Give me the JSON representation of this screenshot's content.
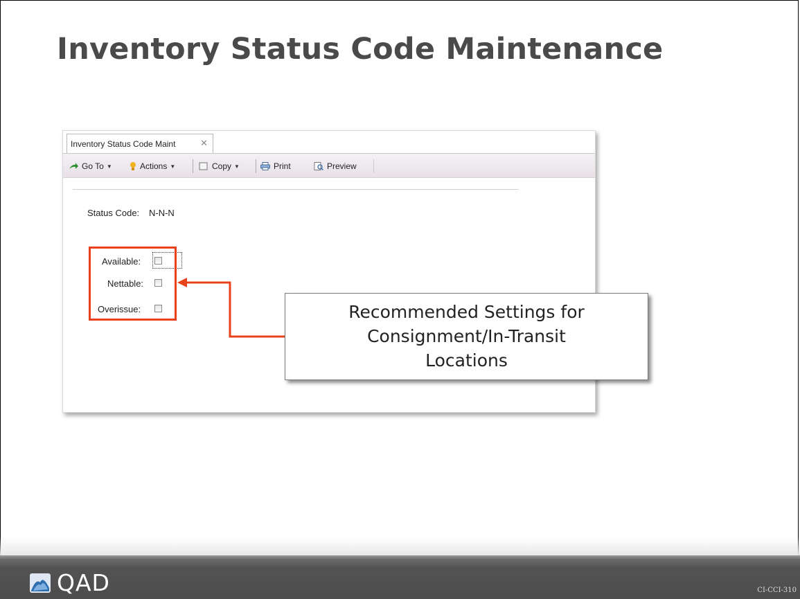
{
  "slide": {
    "title": "Inventory Status Code Maintenance",
    "code": "CI-CCI-310"
  },
  "window": {
    "tab_label": "Inventory Status Code Maint",
    "tab_close": "✕",
    "toolbar": {
      "goto": "Go To",
      "actions": "Actions",
      "copy": "Copy",
      "print": "Print",
      "preview": "Preview"
    },
    "form": {
      "status_code_label": "Status Code:",
      "status_code_value": "N-N-N",
      "fields": [
        {
          "label": "Available:",
          "checked": false
        },
        {
          "label": "Nettable:",
          "checked": false
        },
        {
          "label": "Overissue:",
          "checked": false
        }
      ]
    }
  },
  "callout": {
    "line1": "Recommended Settings for",
    "line2": "Consignment/In-Transit",
    "line3": "Locations"
  },
  "logo": {
    "text": "QAD"
  },
  "colors": {
    "accent": "#e8411b",
    "title": "#4a4a4a",
    "footer": "#4d4d4d"
  }
}
